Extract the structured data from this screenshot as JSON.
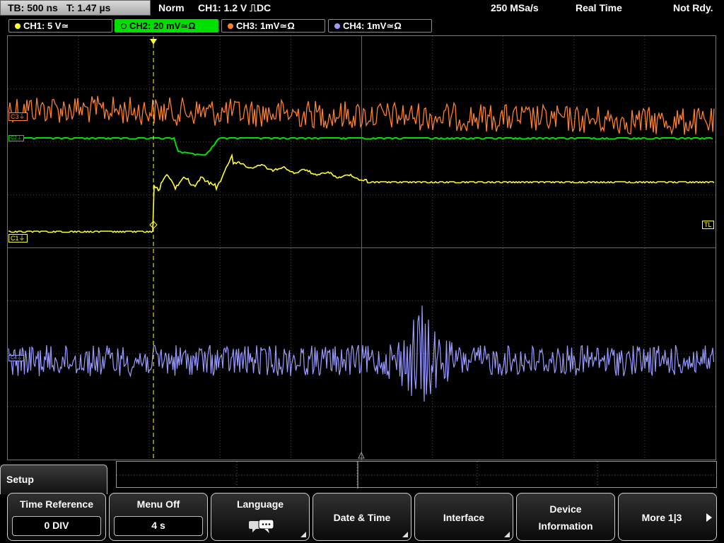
{
  "status": {
    "timebase": "TB: 500 ns",
    "trigger_time": "T: 1.47 µs",
    "mode": "Norm",
    "trigger_info": "CH1: 1.2 V",
    "trigger_slope_coupling": "⎍DC",
    "sample_rate": "250 MSa/s",
    "acq_mode": "Real Time",
    "ready_state": "Not Rdy."
  },
  "channels": [
    {
      "label": "CH1: 5 V",
      "coupling": "≃",
      "color": "#ffff30",
      "active": false
    },
    {
      "label": "CH2: 20 mV",
      "coupling": "≃Ω",
      "color": "#00e000",
      "active": true
    },
    {
      "label": "CH3: 1mV",
      "coupling": "≃Ω",
      "color": "#ff7f2a",
      "active": false
    },
    {
      "label": "CH4: 1mV",
      "coupling": "≃Ω",
      "color": "#9a9aff",
      "active": false
    }
  ],
  "markers": {
    "c3": "C3",
    "c2": "C2",
    "c1": "C1",
    "c4": "C4",
    "trigger_level": "TL",
    "trigger_pos": "T"
  },
  "menu": {
    "title": "Setup",
    "softkeys": [
      {
        "label": "Time Reference",
        "value": "0 DIV"
      },
      {
        "label": "Menu Off",
        "value": "4 s"
      },
      {
        "label": "Language",
        "icon": "speech-bubble-icon"
      },
      {
        "label": "Date & Time"
      },
      {
        "label": "Interface"
      },
      {
        "label_line1": "Device",
        "label_line2": "Information"
      },
      {
        "label": "More 1|3"
      }
    ]
  },
  "colors": {
    "ch1": "#ffff30",
    "ch2": "#00e000",
    "ch3": "#ff7f2a",
    "ch4": "#9a9aff",
    "grid": "#555555"
  }
}
